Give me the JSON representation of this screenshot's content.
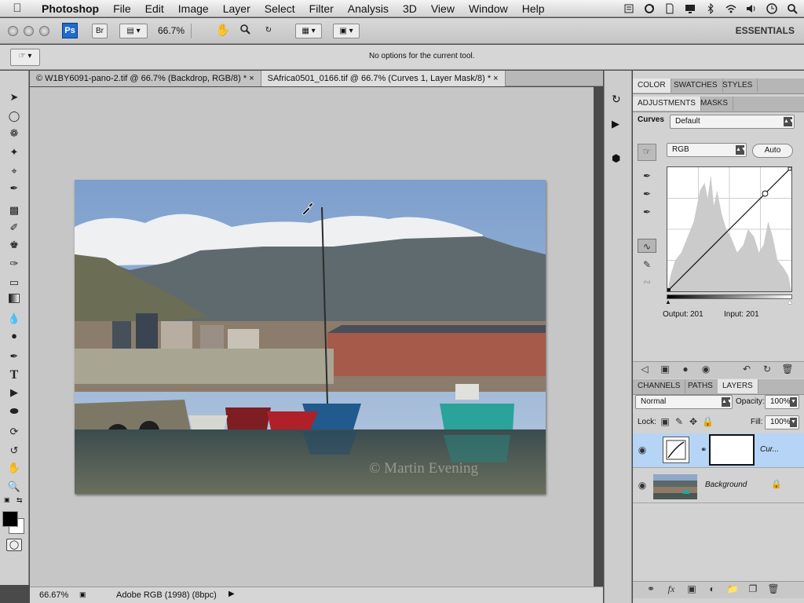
{
  "menubar": {
    "app": "Photoshop",
    "items": [
      "File",
      "Edit",
      "Image",
      "Layer",
      "Select",
      "Filter",
      "Analysis",
      "3D",
      "View",
      "Window",
      "Help"
    ]
  },
  "appbar": {
    "ps": "Ps",
    "bridge": "Br",
    "zoom": "66.7%",
    "workspace": "ESSENTIALS"
  },
  "options": {
    "message": "No options for the current tool."
  },
  "tabs": [
    {
      "label": "© W1BY6091-pano-2.tif @ 66.7% (Backdrop, RGB/8) *",
      "close": "×"
    },
    {
      "label": "SAfrica0501_0166.tif @ 66.7% (Curves 1, Layer Mask/8) *",
      "close": "×"
    }
  ],
  "status": {
    "zoom": "66.67%",
    "profile": "Adobe RGB (1998) (8bpc)"
  },
  "photo": {
    "watermark": "© Martin Evening"
  },
  "panel_top_tabs": [
    "COLOR",
    "SWATCHES",
    "STYLES"
  ],
  "panel_adj_tabs": [
    "ADJUSTMENTS",
    "MASKS"
  ],
  "curves": {
    "label": "Curves",
    "preset": "Default",
    "channel": "RGB",
    "auto": "Auto",
    "output_label": "Output:",
    "output": "201",
    "input_label": "Input:",
    "input": "201"
  },
  "layers_tabs": [
    "CHANNELS",
    "PATHS",
    "LAYERS"
  ],
  "layers": {
    "blend": "Normal",
    "opacity_label": "Opacity:",
    "opacity": "100%",
    "lock_label": "Lock:",
    "fill_label": "Fill:",
    "fill": "100%",
    "items": [
      {
        "name": "Cur..."
      },
      {
        "name": "Background"
      }
    ]
  }
}
